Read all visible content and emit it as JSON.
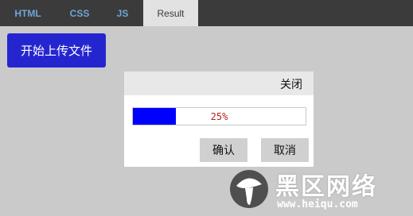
{
  "tabs": [
    {
      "label": "HTML"
    },
    {
      "label": "CSS"
    },
    {
      "label": "JS"
    },
    {
      "label": "Result"
    }
  ],
  "active_tab": "Result",
  "upload_button": {
    "label": "开始上传文件"
  },
  "dialog": {
    "close_label": "关闭",
    "progress": {
      "percent": 25,
      "text": "25%"
    },
    "confirm_label": "确认",
    "cancel_label": "取消"
  },
  "watermark": {
    "title": "黑区网络",
    "url": "www.heiqu.com"
  },
  "colors": {
    "accent_button": "#2525d0",
    "progress_fill": "#0000ff",
    "progress_text": "#b22222",
    "tabbar": "#3b3b3b"
  }
}
